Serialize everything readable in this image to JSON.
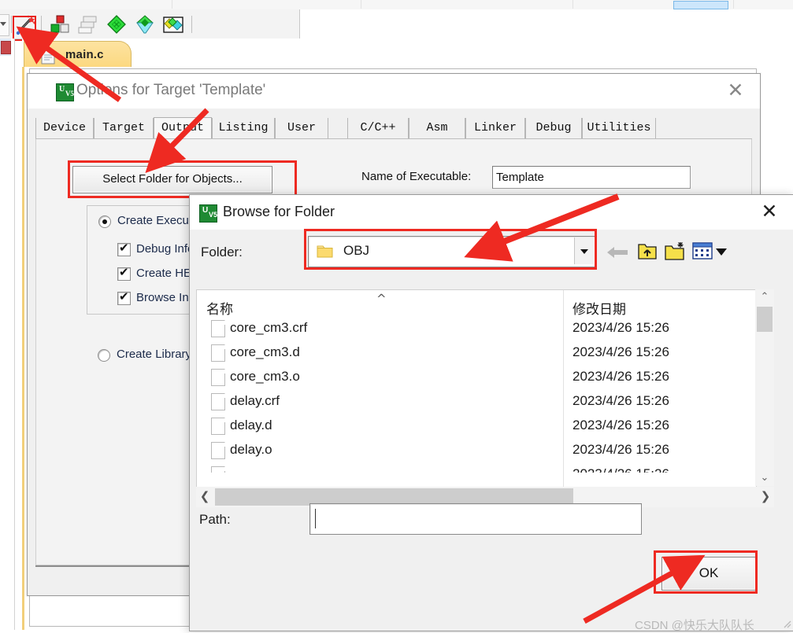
{
  "ide": {
    "toolbar": {
      "icons": [
        {
          "name": "target-options-icon",
          "focused": true
        },
        {
          "name": "manage-project-items-icon",
          "focused": false
        },
        {
          "name": "manage-multi-project-icon",
          "focused": false
        },
        {
          "name": "configuration-wizard-green-icon",
          "focused": false
        },
        {
          "name": "filter-icon",
          "focused": false
        },
        {
          "name": "pack-installer-icon",
          "focused": false
        }
      ]
    },
    "editor_tab": {
      "label": "main.c",
      "icon": "c-source-file-icon"
    }
  },
  "options_dialog": {
    "title": "Options for Target 'Template'",
    "logo": "keil-uvision-logo",
    "close_label": "✕",
    "tabs": [
      {
        "label": "Device",
        "active": false
      },
      {
        "label": "Target",
        "active": false
      },
      {
        "label": "Output",
        "active": true
      },
      {
        "label": "Listing",
        "active": false
      },
      {
        "label": "User",
        "active": false
      },
      {
        "label": "C/C++",
        "active": false
      },
      {
        "label": "Asm",
        "active": false
      },
      {
        "label": "Linker",
        "active": false
      },
      {
        "label": "Debug",
        "active": false
      },
      {
        "label": "Utilities",
        "active": false
      }
    ],
    "select_folder_button": "Select Folder for Objects...",
    "executable_label": "Name of Executable:",
    "executable_value": "Template",
    "create_executable": {
      "label": "Create Executable",
      "selected": true
    },
    "checkboxes": [
      {
        "label": "Debug Informat",
        "checked": true
      },
      {
        "label": "Create HEX File",
        "checked": true
      },
      {
        "label": "Browse Informat",
        "checked": true
      }
    ],
    "create_library": {
      "label": "Create Library:  ..\\",
      "selected": false
    }
  },
  "browse_dialog": {
    "title": "Browse for Folder",
    "logo": "keil-uvision-logo",
    "close_label": "✕",
    "folder_label": "Folder:",
    "folder_value": "OBJ",
    "folder_icon": "folder-icon",
    "dropdown_icon": "chevron-down-icon",
    "toolbar_icons": [
      {
        "name": "back-arrow-icon"
      },
      {
        "name": "up-one-level-icon"
      },
      {
        "name": "new-folder-icon"
      },
      {
        "name": "view-mode-icon"
      },
      {
        "name": "view-mode-dropdown-icon"
      }
    ],
    "columns": [
      "名称",
      "修改日期"
    ],
    "sort_indicator": "^",
    "files": [
      {
        "name": "core_cm3.crf",
        "date": "2023/4/26 15:26"
      },
      {
        "name": "core_cm3.d",
        "date": "2023/4/26 15:26"
      },
      {
        "name": "core_cm3.o",
        "date": "2023/4/26 15:26"
      },
      {
        "name": "delay.crf",
        "date": "2023/4/26 15:26"
      },
      {
        "name": "delay.d",
        "date": "2023/4/26 15:26"
      },
      {
        "name": "delay.o",
        "date": "2023/4/26 15:26"
      }
    ],
    "scroll_up": "⌃",
    "scroll_down": "⌄",
    "scroll_left": "❮",
    "scroll_right": "❯",
    "path_label": "Path:",
    "path_value": "",
    "ok_button": "OK"
  },
  "watermark": "CSDN @快乐大队队长",
  "colors": {
    "highlight_red": "#ee2a22",
    "tab_yellow": "#fcd87f",
    "keil_green": "#1f8a33",
    "dialog_gray": "#f0f0f0"
  }
}
